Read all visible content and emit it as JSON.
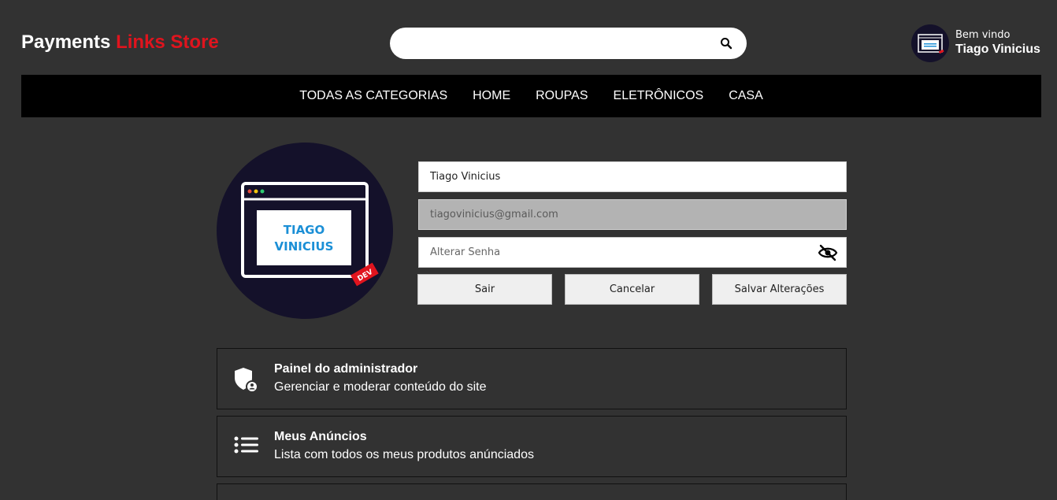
{
  "header": {
    "brand_part1": "Payments ",
    "brand_part2": "Links Store",
    "search_value": "",
    "welcome_label": "Bem vindo",
    "user_name": "Tiago Vinicius"
  },
  "nav": {
    "items": [
      "TODAS AS CATEGORIAS",
      "HOME",
      "ROUPAS",
      "ELETRÔNICOS",
      "CASA"
    ]
  },
  "avatar": {
    "line1": "TIAGO",
    "line2": "VINICIUS",
    "badge": "DEV"
  },
  "profile_form": {
    "name_value": "Tiago Vinicius",
    "email_value": "tiagovinicius@gmail.com",
    "password_placeholder": "Alterar Senha",
    "logout_label": "Sair",
    "cancel_label": "Cancelar",
    "save_label": "Salvar Alterações"
  },
  "cards": [
    {
      "title": "Painel do administrador",
      "subtitle": "Gerenciar e moderar conteúdo do site",
      "icon": "shield-user-icon"
    },
    {
      "title": "Meus Anúncios",
      "subtitle": "Lista com todos os meus produtos anúnciados",
      "icon": "list-icon"
    },
    {
      "title": "",
      "subtitle": "",
      "icon": ""
    }
  ],
  "colors": {
    "background": "#323232",
    "accent": "#e0141e",
    "navbar": "#000000",
    "avatar_bg": "#14112a"
  }
}
